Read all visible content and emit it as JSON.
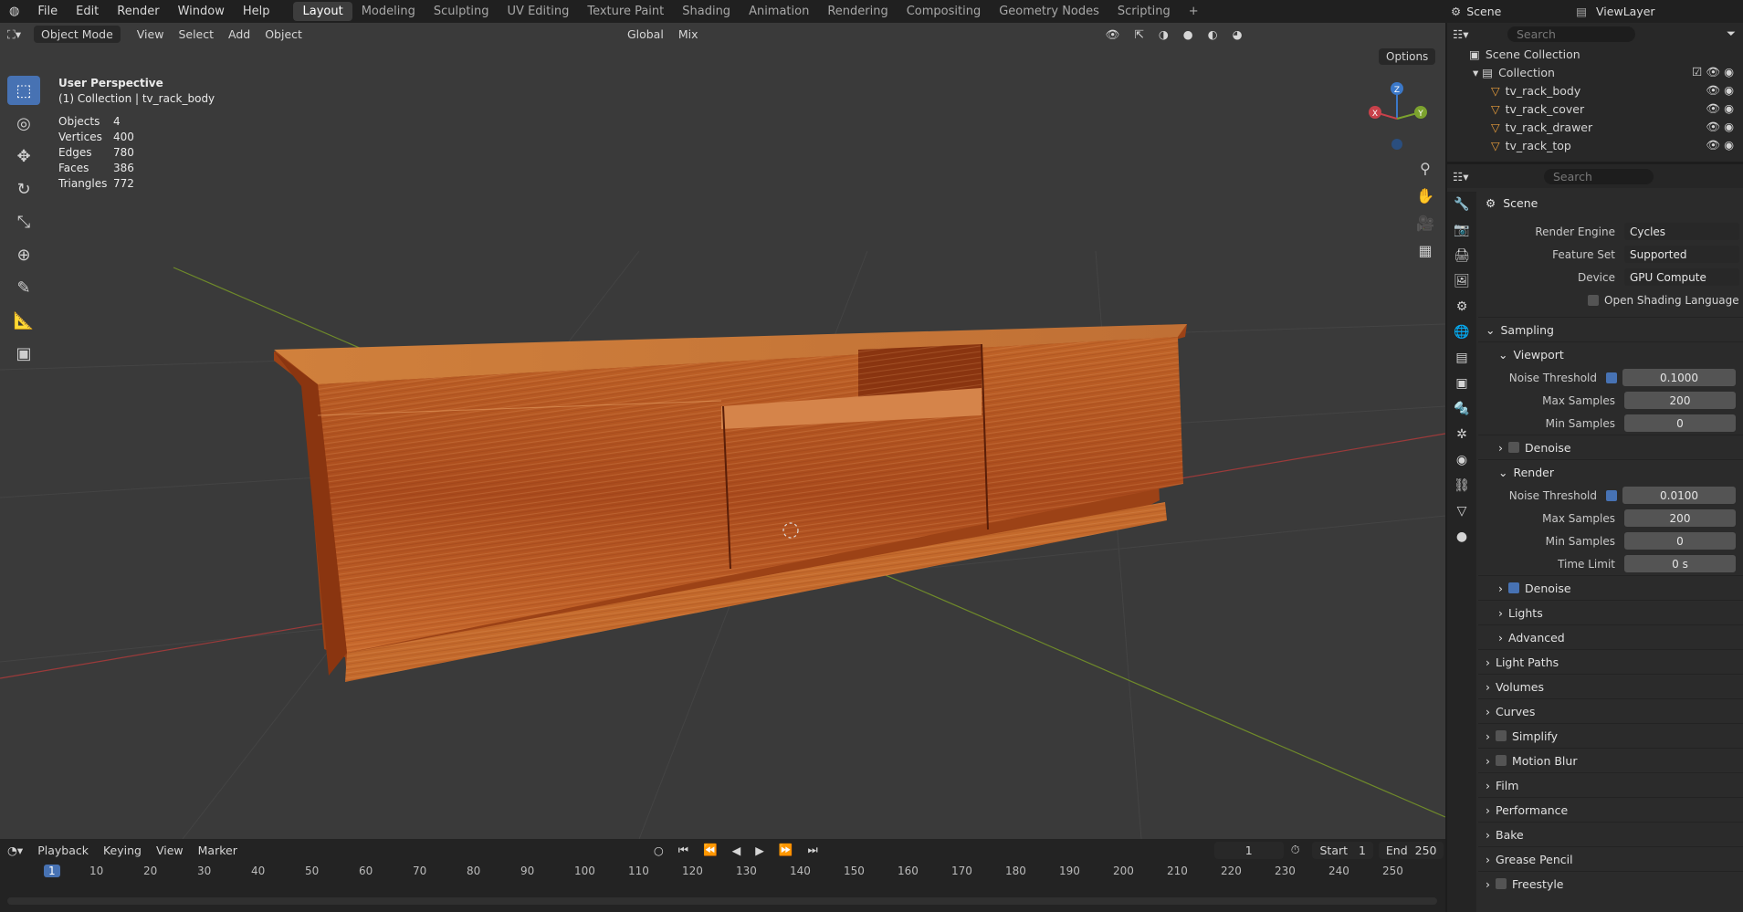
{
  "topbar": {
    "menus": [
      "File",
      "Edit",
      "Render",
      "Window",
      "Help"
    ],
    "workspaces": [
      "Layout",
      "Modeling",
      "Sculpting",
      "UV Editing",
      "Texture Paint",
      "Shading",
      "Animation",
      "Rendering",
      "Compositing",
      "Geometry Nodes",
      "Scripting"
    ],
    "active_workspace": "Layout",
    "add_ws": "+",
    "scene": "Scene",
    "view_layer": "ViewLayer"
  },
  "viewport": {
    "mode": "Object Mode",
    "menus": [
      "View",
      "Select",
      "Add",
      "Object"
    ],
    "transform": "Global",
    "pivot": "Mix",
    "options": "Options",
    "overlay_title": "User Perspective",
    "overlay_subtitle": "(1) Collection | tv_rack_body",
    "stats": [
      {
        "k": "Objects",
        "v": "4"
      },
      {
        "k": "Vertices",
        "v": "400"
      },
      {
        "k": "Edges",
        "v": "780"
      },
      {
        "k": "Faces",
        "v": "386"
      },
      {
        "k": "Triangles",
        "v": "772"
      }
    ],
    "gizmo": {
      "z": "Z",
      "y": "Y",
      "x": "X"
    }
  },
  "outliner": {
    "search_placeholder": "Search",
    "root": "Scene Collection",
    "collection": "Collection",
    "objects": [
      "tv_rack_body",
      "tv_rack_cover",
      "tv_rack_drawer",
      "tv_rack_top"
    ]
  },
  "properties": {
    "search_placeholder": "Search",
    "context": "Scene",
    "render_engine_label": "Render Engine",
    "render_engine": "Cycles",
    "feature_set_label": "Feature Set",
    "feature_set": "Supported",
    "device_label": "Device",
    "device": "GPU Compute",
    "osl": "Open Shading Language",
    "sampling": "Sampling",
    "viewport": "Viewport",
    "noise_threshold": "Noise Threshold",
    "max_samples": "Max Samples",
    "min_samples": "Min Samples",
    "time_limit": "Time Limit",
    "vp_noise": "0.1000",
    "vp_max": "200",
    "vp_min": "0",
    "denoise": "Denoise",
    "render": "Render",
    "r_noise": "0.0100",
    "r_max": "200",
    "r_min": "0",
    "r_time": "0 s",
    "lights": "Lights",
    "advanced": "Advanced",
    "sections": [
      "Light Paths",
      "Volumes",
      "Curves",
      "Simplify",
      "Motion Blur",
      "Film",
      "Performance",
      "Bake",
      "Grease Pencil",
      "Freestyle"
    ]
  },
  "timeline": {
    "menus": [
      "Playback",
      "Keying",
      "View",
      "Marker"
    ],
    "current_frame": "1",
    "start_label": "Start",
    "start": "1",
    "end_label": "End",
    "end": "250",
    "ticks": [
      "1",
      "10",
      "20",
      "30",
      "40",
      "50",
      "60",
      "70",
      "80",
      "90",
      "100",
      "110",
      "120",
      "130",
      "140",
      "150",
      "160",
      "170",
      "180",
      "190",
      "200",
      "210",
      "220",
      "230",
      "240",
      "250"
    ]
  }
}
